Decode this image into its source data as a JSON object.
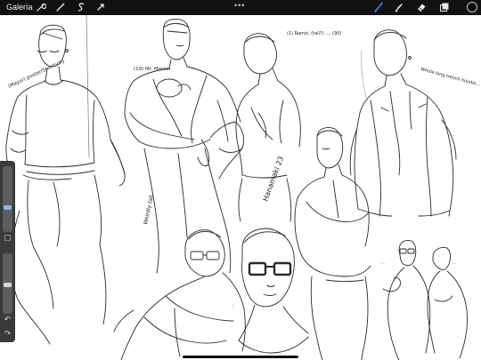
{
  "app": {
    "gallery_label": "Galería",
    "more_glyph": "•••"
  },
  "toolbar": {
    "left_icons": [
      "wrench-icon",
      "magic-wand-icon",
      "selection-s-icon",
      "transform-arrow-icon"
    ],
    "right_icons": [
      "brush-icon",
      "smudge-icon",
      "eraser-icon",
      "layers-icon"
    ],
    "active_tool": "brush-icon",
    "active_color": "#000000",
    "accent": "#2f7cf6"
  },
  "sidebar": {
    "brush_size": 0.55,
    "opacity": 0.3,
    "modify_glyph": "▢",
    "undo_glyph": "↶",
    "redo_glyph": "↷"
  },
  "annotations": {
    "left_note": "(Mayor) poster/Sherlocky",
    "mid_note": "(19) Mr. Marcel",
    "top_note": "(1) Ramzi, (tall?) ..., (90)",
    "right_note": "Whole long trench hoodie...",
    "vertical_1": "Weirdly tall",
    "vertical_2": "Hanamaki 23",
    "vertical_3": "...",
    "small_note_1": "...",
    "small_note_2": "..."
  }
}
